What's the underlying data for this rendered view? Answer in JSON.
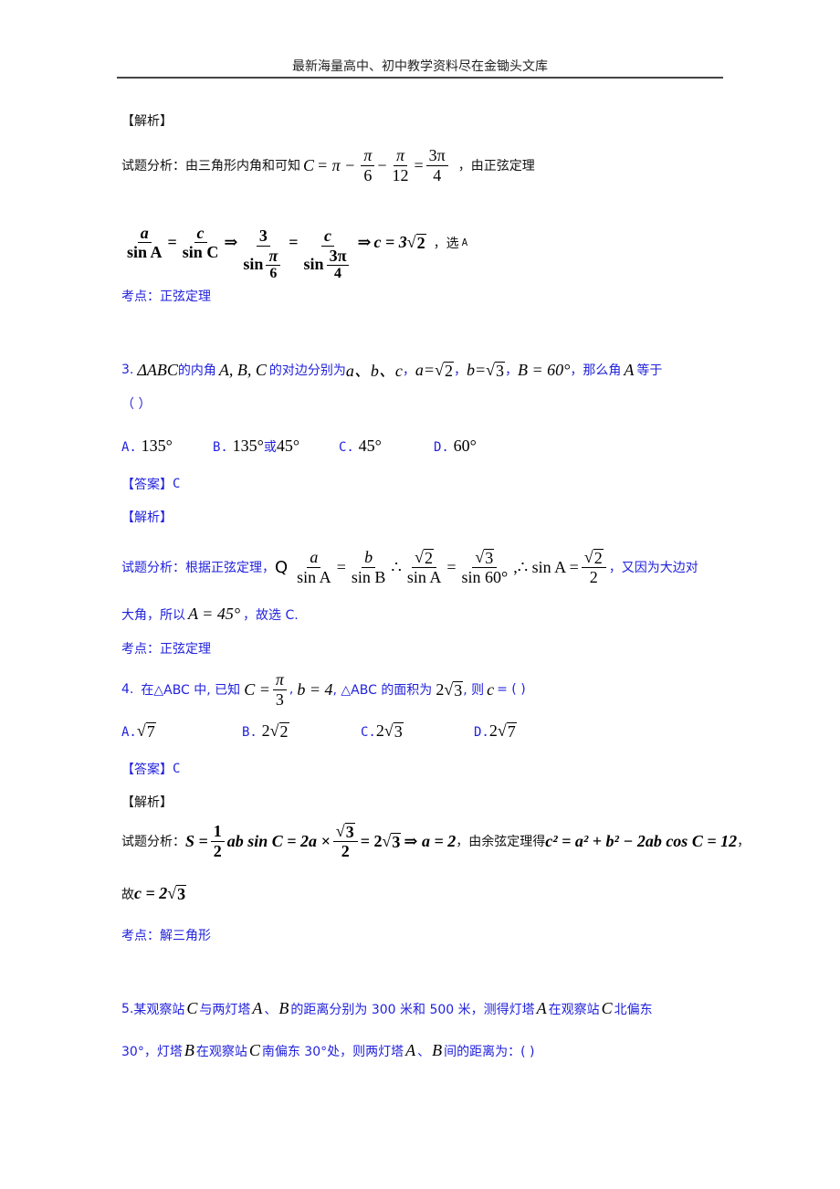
{
  "header": {
    "title": "最新海量高中、初中教学资料尽在金锄头文库"
  },
  "q2_solution": {
    "analysis_label": "【解析】",
    "line1_prefix": "试题分析：由三角形内角和可知",
    "line1_eq": {
      "lhs": "C",
      "eq": "= π −",
      "f1n": "π",
      "f1d": "6",
      "minus": "−",
      "f2n": "π",
      "f2d": "12",
      "eq2": "=",
      "f3n": "3π",
      "f3d": "4"
    },
    "line1_suffix": "，由正弦定理",
    "line2": {
      "f1n": "a",
      "f1d": "sin A",
      "eq": "=",
      "f2n": "c",
      "f2d": "sin C",
      "imp": "⇒",
      "f3n": "3",
      "f3d_sin": "sin",
      "f3d_n": "π",
      "f3d_d": "6",
      "eq2": "=",
      "f4n": "c",
      "f4d_sin": "sin",
      "f4d_n": "3π",
      "f4d_d": "4",
      "imp2": "⇒",
      "res": "c = 3",
      "rad": "2"
    },
    "line2_suffix": "，选",
    "choice": "A",
    "topic_label": "考点：",
    "topic": "正弦定理"
  },
  "q3": {
    "number": "3.",
    "stem_math1": "ΔABC",
    "stem_t1": "的内角",
    "stem_math2": "A, B, C",
    "stem_t2": "的对边分别为",
    "stem_math3": "a、b、c",
    "sep1": "，",
    "a_eq": "a=",
    "a_rad": "2",
    "sep2": "，",
    "b_eq": "b=",
    "b_rad": "3",
    "sep3": "，",
    "B_eq": "B = 60°",
    "stem_t3": "，那么角",
    "A_var": "A",
    "stem_t4": "等于",
    "paren": "（        ）",
    "options": [
      {
        "label": "A.",
        "value": "135°"
      },
      {
        "label": "B.",
        "value": "135°",
        "mid": "或",
        "value2": "45°"
      },
      {
        "label": "C.",
        "value": "45°"
      },
      {
        "label": "D.",
        "value": "60°"
      }
    ],
    "answer_label": "【答案】",
    "answer": "C",
    "analysis_label": "【解析】",
    "analysis_prefix": "试题分析：根据正弦定理，",
    "analysis_math": {
      "because": "Q",
      "f1n": "a",
      "f1d": "sin A",
      "eq": "=",
      "f2n": "b",
      "f2d": "sin B",
      "therefore": "∴",
      "f3n_rad": "2",
      "f3d": "sin A",
      "eq2": "=",
      "f4n_rad": "3",
      "f4d": "sin 60°",
      "therefore2": ",∴ sin A =",
      "f5n_rad": "2",
      "f5d": "2"
    },
    "analysis_suffix": "，又因为大边对",
    "analysis_line2_t1": "大角，所以",
    "analysis_line2_math": "A = 45°",
    "analysis_line2_t2": "，故选 C.",
    "topic_label": "考点：",
    "topic": "正弦定理"
  },
  "q4": {
    "number": "4.",
    "t1": "在△ABC 中, 已知",
    "C_lhs": "C =",
    "C_num": "π",
    "C_den": "3",
    "t2": ",",
    "b_eq": "b = 4",
    "t3": ", △ABC 的面积为",
    "area": "2",
    "area_rad": "3",
    "t4": ", 则",
    "c_var": "c",
    "t5": "= (        )",
    "options": [
      {
        "label": "A.",
        "coef": "",
        "rad": "7"
      },
      {
        "label": "B.",
        "coef": "2",
        "rad": "2"
      },
      {
        "label": "C.",
        "coef": "2",
        "rad": "3"
      },
      {
        "label": "D.",
        "coef": "2",
        "rad": "7"
      }
    ],
    "answer_label": "【答案】",
    "answer": "C",
    "analysis_label": "【解析】",
    "analysis_prefix": "试题分析：",
    "analysis_math": {
      "s": "S =",
      "f1n": "1",
      "f1d": "2",
      "mid": "ab sin C = 2a ×",
      "f2n_rad": "3",
      "f2d": "2",
      "eq": "= 2",
      "rad": "3",
      "imp": "⇒ a = 2"
    },
    "analysis_mid": "，由余弦定理得",
    "analysis_math2": "c² = a² + b² − 2ab cos C = 12",
    "analysis_end": "，",
    "line2_t": "故",
    "line2_math": "c = 2",
    "line2_rad": "3",
    "topic_label": "考点：",
    "topic": "解三角形"
  },
  "q5": {
    "number": "5.",
    "t1": "某观察站",
    "C1": "C",
    "t2": "与两灯塔",
    "A1": "A",
    "t3": "、",
    "B1": "B",
    "t4": "的距离分别为 300 米和 500 米，测得灯塔",
    "A2": "A",
    "t5": "在观察站",
    "C2": "C",
    "t6": "北偏东",
    "l2_t1": "30°，灯塔",
    "B2": "B",
    "l2_t2": "在观察站",
    "C3": "C",
    "l2_t3": "南偏东 30°处，则两灯塔",
    "A3": "A",
    "l2_t4": "、",
    "B3": "B",
    "l2_t5": "间的距离为：(          )"
  }
}
